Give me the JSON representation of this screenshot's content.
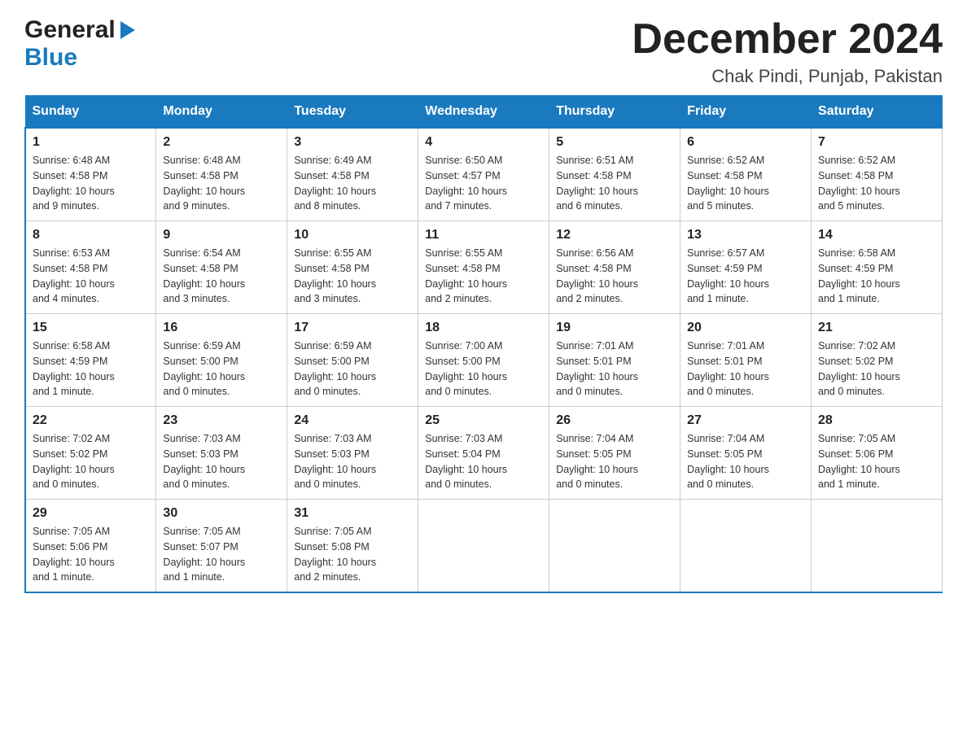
{
  "header": {
    "logo_general": "General",
    "logo_blue": "Blue",
    "month_title": "December 2024",
    "location": "Chak Pindi, Punjab, Pakistan"
  },
  "days_of_week": [
    "Sunday",
    "Monday",
    "Tuesday",
    "Wednesday",
    "Thursday",
    "Friday",
    "Saturday"
  ],
  "weeks": [
    [
      {
        "day": "1",
        "sunrise": "6:48 AM",
        "sunset": "4:58 PM",
        "daylight": "10 hours and 9 minutes."
      },
      {
        "day": "2",
        "sunrise": "6:48 AM",
        "sunset": "4:58 PM",
        "daylight": "10 hours and 9 minutes."
      },
      {
        "day": "3",
        "sunrise": "6:49 AM",
        "sunset": "4:58 PM",
        "daylight": "10 hours and 8 minutes."
      },
      {
        "day": "4",
        "sunrise": "6:50 AM",
        "sunset": "4:57 PM",
        "daylight": "10 hours and 7 minutes."
      },
      {
        "day": "5",
        "sunrise": "6:51 AM",
        "sunset": "4:58 PM",
        "daylight": "10 hours and 6 minutes."
      },
      {
        "day": "6",
        "sunrise": "6:52 AM",
        "sunset": "4:58 PM",
        "daylight": "10 hours and 5 minutes."
      },
      {
        "day": "7",
        "sunrise": "6:52 AM",
        "sunset": "4:58 PM",
        "daylight": "10 hours and 5 minutes."
      }
    ],
    [
      {
        "day": "8",
        "sunrise": "6:53 AM",
        "sunset": "4:58 PM",
        "daylight": "10 hours and 4 minutes."
      },
      {
        "day": "9",
        "sunrise": "6:54 AM",
        "sunset": "4:58 PM",
        "daylight": "10 hours and 3 minutes."
      },
      {
        "day": "10",
        "sunrise": "6:55 AM",
        "sunset": "4:58 PM",
        "daylight": "10 hours and 3 minutes."
      },
      {
        "day": "11",
        "sunrise": "6:55 AM",
        "sunset": "4:58 PM",
        "daylight": "10 hours and 2 minutes."
      },
      {
        "day": "12",
        "sunrise": "6:56 AM",
        "sunset": "4:58 PM",
        "daylight": "10 hours and 2 minutes."
      },
      {
        "day": "13",
        "sunrise": "6:57 AM",
        "sunset": "4:59 PM",
        "daylight": "10 hours and 1 minute."
      },
      {
        "day": "14",
        "sunrise": "6:58 AM",
        "sunset": "4:59 PM",
        "daylight": "10 hours and 1 minute."
      }
    ],
    [
      {
        "day": "15",
        "sunrise": "6:58 AM",
        "sunset": "4:59 PM",
        "daylight": "10 hours and 1 minute."
      },
      {
        "day": "16",
        "sunrise": "6:59 AM",
        "sunset": "5:00 PM",
        "daylight": "10 hours and 0 minutes."
      },
      {
        "day": "17",
        "sunrise": "6:59 AM",
        "sunset": "5:00 PM",
        "daylight": "10 hours and 0 minutes."
      },
      {
        "day": "18",
        "sunrise": "7:00 AM",
        "sunset": "5:00 PM",
        "daylight": "10 hours and 0 minutes."
      },
      {
        "day": "19",
        "sunrise": "7:01 AM",
        "sunset": "5:01 PM",
        "daylight": "10 hours and 0 minutes."
      },
      {
        "day": "20",
        "sunrise": "7:01 AM",
        "sunset": "5:01 PM",
        "daylight": "10 hours and 0 minutes."
      },
      {
        "day": "21",
        "sunrise": "7:02 AM",
        "sunset": "5:02 PM",
        "daylight": "10 hours and 0 minutes."
      }
    ],
    [
      {
        "day": "22",
        "sunrise": "7:02 AM",
        "sunset": "5:02 PM",
        "daylight": "10 hours and 0 minutes."
      },
      {
        "day": "23",
        "sunrise": "7:03 AM",
        "sunset": "5:03 PM",
        "daylight": "10 hours and 0 minutes."
      },
      {
        "day": "24",
        "sunrise": "7:03 AM",
        "sunset": "5:03 PM",
        "daylight": "10 hours and 0 minutes."
      },
      {
        "day": "25",
        "sunrise": "7:03 AM",
        "sunset": "5:04 PM",
        "daylight": "10 hours and 0 minutes."
      },
      {
        "day": "26",
        "sunrise": "7:04 AM",
        "sunset": "5:05 PM",
        "daylight": "10 hours and 0 minutes."
      },
      {
        "day": "27",
        "sunrise": "7:04 AM",
        "sunset": "5:05 PM",
        "daylight": "10 hours and 0 minutes."
      },
      {
        "day": "28",
        "sunrise": "7:05 AM",
        "sunset": "5:06 PM",
        "daylight": "10 hours and 1 minute."
      }
    ],
    [
      {
        "day": "29",
        "sunrise": "7:05 AM",
        "sunset": "5:06 PM",
        "daylight": "10 hours and 1 minute."
      },
      {
        "day": "30",
        "sunrise": "7:05 AM",
        "sunset": "5:07 PM",
        "daylight": "10 hours and 1 minute."
      },
      {
        "day": "31",
        "sunrise": "7:05 AM",
        "sunset": "5:08 PM",
        "daylight": "10 hours and 2 minutes."
      },
      null,
      null,
      null,
      null
    ]
  ],
  "labels": {
    "sunrise": "Sunrise:",
    "sunset": "Sunset:",
    "daylight": "Daylight:"
  }
}
